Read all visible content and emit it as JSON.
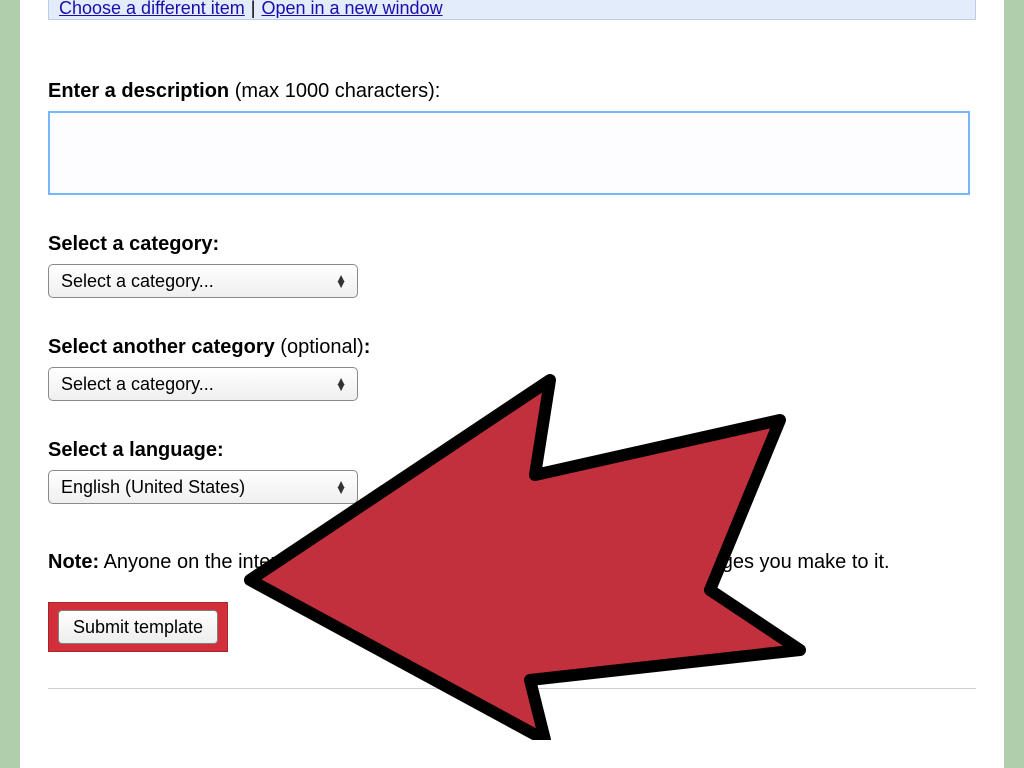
{
  "info_bar": {
    "choose_link": "Choose a different item",
    "separator": "|",
    "open_link": "Open in a new window"
  },
  "description": {
    "label_bold": "Enter a description",
    "label_rest": " (max 1000 characters):",
    "value": ""
  },
  "category1": {
    "label": "Select a category:",
    "selected": "Select a category..."
  },
  "category2": {
    "label_bold": "Select another category",
    "label_rest": " (optional)",
    "label_colon": ":",
    "selected": "Select a category..."
  },
  "language": {
    "label": "Select a language:",
    "selected": "English (United States)"
  },
  "note": {
    "prefix": "Note:",
    "text": " Anyone on the internet will be able to find your template and any changes you make to it."
  },
  "submit": {
    "label": "Submit template"
  }
}
